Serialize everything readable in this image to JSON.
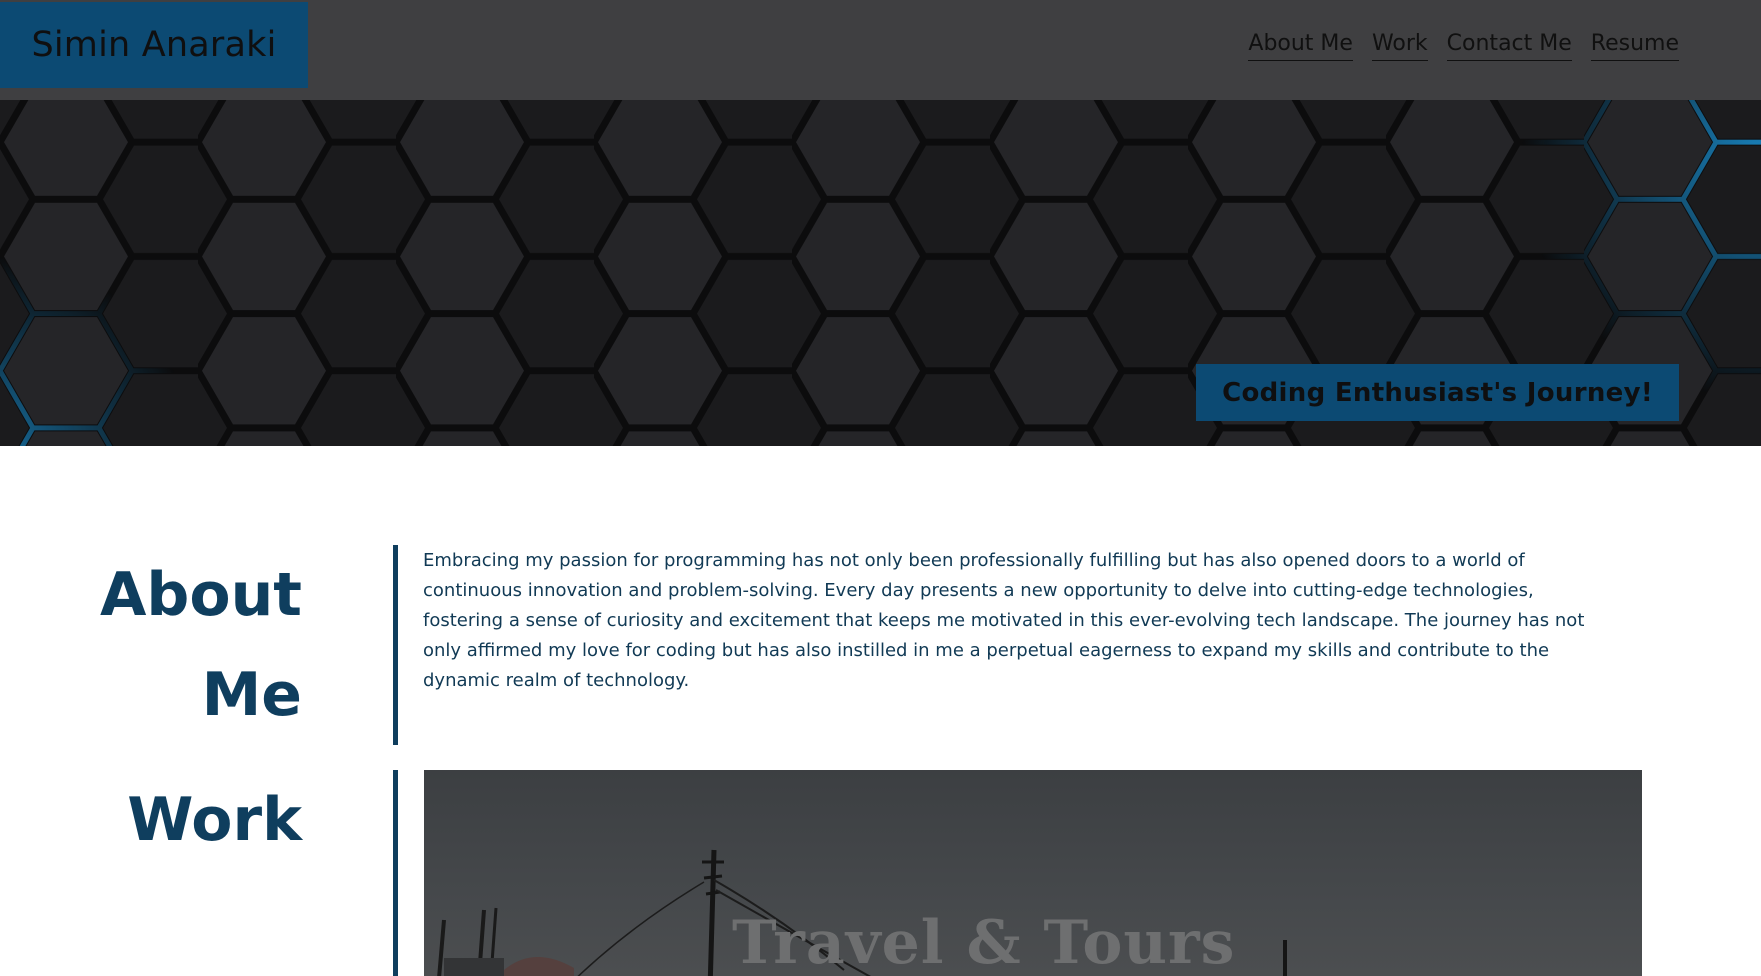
{
  "header": {
    "brand": "Simin Anaraki",
    "nav": [
      {
        "label": "About Me"
      },
      {
        "label": "Work"
      },
      {
        "label": "Contact Me"
      },
      {
        "label": "Resume"
      }
    ]
  },
  "hero": {
    "tagline": "Coding Enthusiast's Journey!"
  },
  "about": {
    "title_line1": "About",
    "title_line2": "Me",
    "body": "Embracing my passion for programming has not only been professionally fulfilling but has also opened doors to a world of continuous innovation and problem-solving. Every day presents a new opportunity to delve into cutting-edge technologies, fostering a sense of curiosity and excitement that keeps me motivated in this ever-evolving tech landscape. The journey has not only affirmed my love for coding but has also instilled in me a perpetual eagerness to expand my skills and contribute to the dynamic realm of technology."
  },
  "work": {
    "title": "Work",
    "projects": [
      {
        "title": "Travel & Tours"
      }
    ]
  },
  "colors": {
    "header_bg": "#3f3f41",
    "accent": "#0c4a73",
    "heading": "#0f3e5e",
    "hero_bg": "#1b1b1d",
    "hex_glow": "#1a8fd0"
  },
  "icons": {
    "hero_pattern": "hexagon-pattern"
  }
}
